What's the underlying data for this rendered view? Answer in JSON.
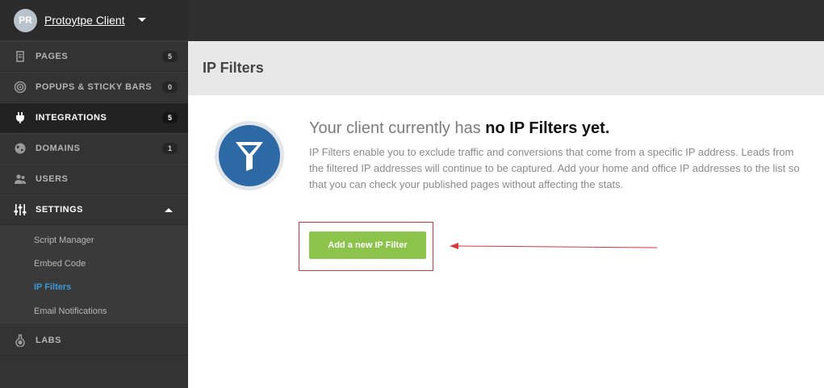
{
  "client": {
    "initials": "PR",
    "name": "Protoytpe Client"
  },
  "nav": [
    {
      "label": "PAGES",
      "badge": "5",
      "icon": "pages-icon"
    },
    {
      "label": "POPUPS & STICKY BARS",
      "badge": "0",
      "icon": "target-icon"
    },
    {
      "label": "INTEGRATIONS",
      "badge": "5",
      "icon": "plug-icon"
    },
    {
      "label": "DOMAINS",
      "badge": "1",
      "icon": "globe-icon"
    },
    {
      "label": "USERS",
      "badge": "",
      "icon": "users-icon"
    },
    {
      "label": "SETTINGS",
      "badge": "",
      "icon": "sliders-icon"
    },
    {
      "label": "LABS",
      "badge": "",
      "icon": "flask-icon"
    }
  ],
  "settings_sub": [
    {
      "label": "Script Manager"
    },
    {
      "label": "Embed Code"
    },
    {
      "label": "IP Filters"
    },
    {
      "label": "Email Notifications"
    }
  ],
  "page": {
    "title": "IP Filters"
  },
  "empty_state": {
    "headline_prefix": "Your client currently has ",
    "headline_strong": "no IP Filters yet.",
    "description": "IP Filters enable you to exclude traffic and conversions that come from a specific IP address. Leads from the filtered IP addresses will continue to be captured. Add your home and office IP addresses to the list so that you can check your published pages without affecting the stats.",
    "button_label": "Add a new IP Filter"
  },
  "colors": {
    "accent_green": "#8cc34a",
    "filter_blue": "#2d6aa5",
    "highlight_red": "#d9363e",
    "active_link": "#3a9ad9"
  }
}
